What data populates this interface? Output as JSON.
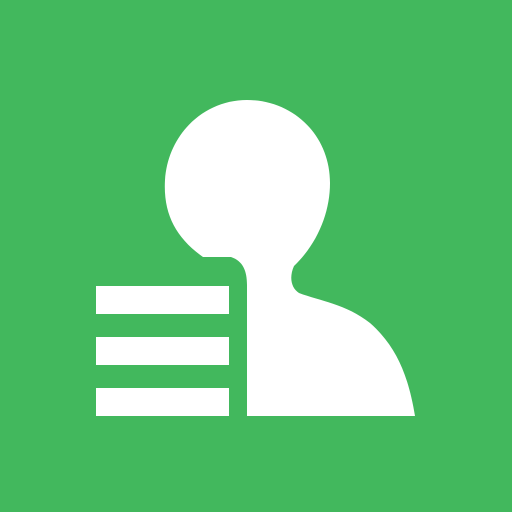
{
  "icon": {
    "name": "contacts-list-icon",
    "background_color": "#42b85d",
    "foreground_color": "#ffffff",
    "list_line_count": 3
  }
}
